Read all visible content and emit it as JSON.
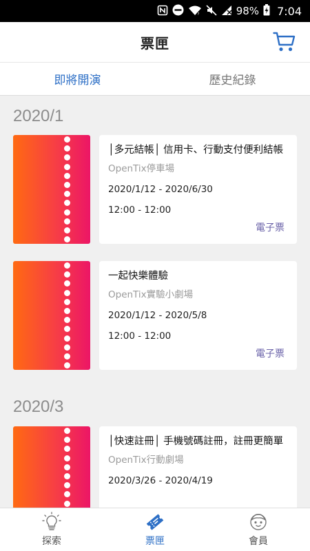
{
  "status_bar": {
    "icons": [
      "nfc-icon",
      "do-not-disturb-icon",
      "wifi-icon",
      "mute-icon",
      "signal-icon"
    ],
    "battery": "98%",
    "time": "7:04"
  },
  "header": {
    "title": "票匣"
  },
  "tabs": [
    {
      "label": "即將開演",
      "active": true
    },
    {
      "label": "歷史紀錄",
      "active": false
    }
  ],
  "groups": [
    {
      "month": "2020/1",
      "tickets": [
        {
          "title": "│多元結帳│ 信用卡、行動支付便利結帳",
          "venue": "OpenTix停車場",
          "date": "2020/1/12 - 2020/6/30",
          "time": "12:00 - 12:00",
          "type": "電子票"
        },
        {
          "title": "一起快樂體驗",
          "venue": "OpenTix實驗小劇場",
          "date": "2020/1/12 - 2020/5/8",
          "time": "12:00 - 12:00",
          "type": "電子票"
        }
      ]
    },
    {
      "month": "2020/3",
      "tickets": [
        {
          "title": "│快速註冊│ 手機號碼註冊，註冊更簡單",
          "venue": "OpenTix行動劇場",
          "date": "2020/3/26 - 2020/4/19",
          "time": "",
          "type": ""
        }
      ]
    }
  ],
  "bottom_nav": [
    {
      "label": "探索",
      "icon": "lightbulb-icon",
      "active": false
    },
    {
      "label": "票匣",
      "icon": "ticket-icon",
      "active": true
    },
    {
      "label": "會員",
      "icon": "member-face-icon",
      "active": false
    }
  ],
  "colors": {
    "accent": "#2d6fc6",
    "ticket_type": "#6a62a8",
    "stub_start": "#ff6a12",
    "stub_end": "#ec1666"
  }
}
